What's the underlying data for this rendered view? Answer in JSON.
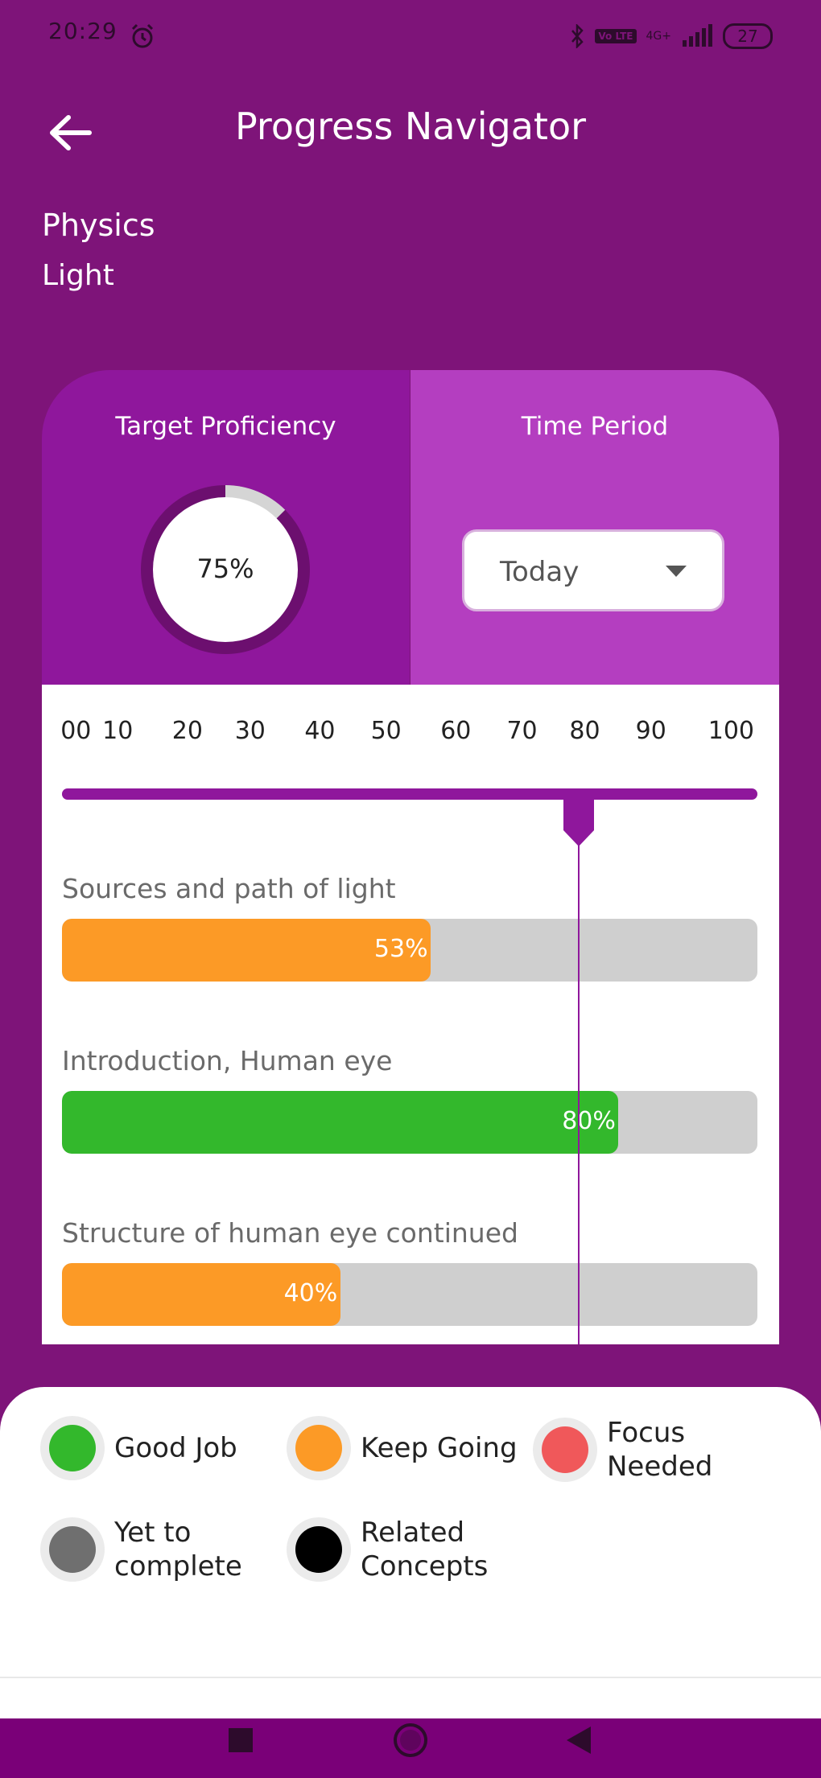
{
  "status_bar": {
    "time": "20:29",
    "network": "4G+",
    "volte": "Vo LTE",
    "battery": "27"
  },
  "header": {
    "title": "Progress Navigator"
  },
  "subject": "Physics",
  "chapter": "Light",
  "card": {
    "target_label": "Target Proficiency",
    "target_value": 75,
    "target_text": "75%",
    "time_label": "Time Period",
    "time_value": "Today",
    "scale": [
      "00",
      "10",
      "20",
      "30",
      "40",
      "50",
      "60",
      "70",
      "80",
      "90",
      "100"
    ],
    "marker_value": 75
  },
  "topics": [
    {
      "label": "Sources and path of light",
      "value": 53,
      "pct_text": "53%",
      "color": "#fc9a26"
    },
    {
      "label": "Introduction, Human eye",
      "value": 80,
      "pct_text": "80%",
      "color": "#33b82c"
    },
    {
      "label": "Structure of human eye continued",
      "value": 40,
      "pct_text": "40%",
      "color": "#fc9a26"
    }
  ],
  "legend": [
    {
      "label": "Good Job",
      "color": "#33b82c"
    },
    {
      "label": "Keep Going",
      "color": "#fc9a26"
    },
    {
      "label": "Focus\nNeeded",
      "color": "#f0585a"
    },
    {
      "label": "Yet to\ncomplete",
      "color": "#6f6f6f"
    },
    {
      "label": "Related\nConcepts",
      "color": "#000000"
    }
  ],
  "colors": {
    "background": "#7e1479",
    "card_left": "#8f179c",
    "card_right": "#b43ec0",
    "accent": "#8f179c"
  }
}
